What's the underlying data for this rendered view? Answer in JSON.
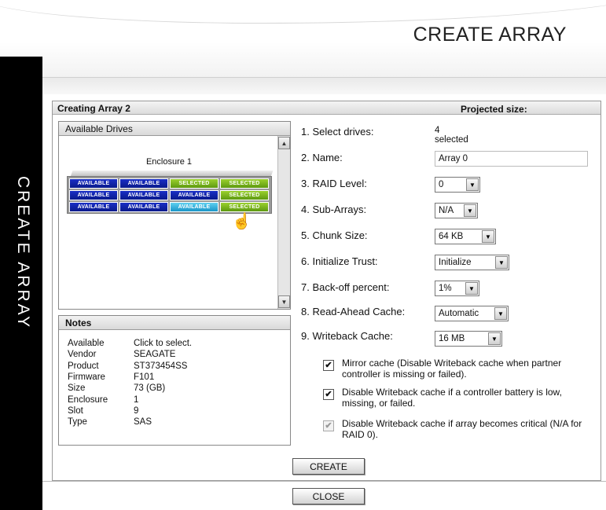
{
  "header": {
    "title": "CREATE ARRAY"
  },
  "sidebar": {
    "label": "CREATE ARRAY"
  },
  "panel": {
    "title": "Creating Array 2",
    "projected_label": "Projected size:",
    "projected_value": ""
  },
  "drives": {
    "title": "Available Drives",
    "enclosure_name": "Enclosure 1",
    "rows": [
      [
        "AVAILABLE",
        "AVAILABLE",
        "SELECTED",
        "SELECTED"
      ],
      [
        "AVAILABLE",
        "AVAILABLE",
        "AVAILABLE",
        "SELECTED"
      ],
      [
        "AVAILABLE",
        "AVAILABLE",
        "AVAILABLE",
        "SELECTED"
      ]
    ],
    "hovered": "row 3, bay 3"
  },
  "notes": {
    "title": "Notes",
    "rows": [
      {
        "key": "Available",
        "value": "Click to select."
      },
      {
        "key": "Vendor",
        "value": "SEAGATE"
      },
      {
        "key": "Product",
        "value": "ST373454SS"
      },
      {
        "key": "Firmware",
        "value": "F101"
      },
      {
        "key": "Size",
        "value": "73 (GB)"
      },
      {
        "key": "Enclosure",
        "value": "1"
      },
      {
        "key": "Slot",
        "value": "9"
      },
      {
        "key": "Type",
        "value": "SAS"
      }
    ]
  },
  "form": {
    "select_drives": {
      "label": "1. Select drives:",
      "value": "4 selected"
    },
    "name": {
      "label": "2. Name:",
      "value": "Array 0"
    },
    "raid_level": {
      "label": "3. RAID Level:",
      "value": "0"
    },
    "sub_arrays": {
      "label": "4. Sub-Arrays:",
      "value": "N/A"
    },
    "chunk_size": {
      "label": "5. Chunk Size:",
      "value": "64 KB"
    },
    "init_trust": {
      "label": "6. Initialize Trust:",
      "value": "Initialize"
    },
    "backoff": {
      "label": "7. Back-off percent:",
      "value": "1%"
    },
    "read_ahead": {
      "label": "8. Read-Ahead Cache:",
      "value": "Automatic"
    },
    "writeback": {
      "label": "9. Writeback Cache:",
      "value": "16 MB"
    }
  },
  "checkboxes": {
    "mirror": {
      "text": "Mirror cache (Disable Writeback cache when partner controller is missing or failed).",
      "checked": true
    },
    "battery": {
      "text": "Disable Writeback cache if a controller battery is low, missing, or failed.",
      "checked": true
    },
    "critical": {
      "text": "Disable Writeback cache if array becomes critical (N/A for RAID 0).",
      "checked": true,
      "disabled": true
    }
  },
  "buttons": {
    "create": "CREATE",
    "close": "CLOSE"
  },
  "colors": {
    "available": "#0a1a8c",
    "selected": "#6aa512",
    "hover": "#1a96c8",
    "sidebar": "#000000"
  }
}
